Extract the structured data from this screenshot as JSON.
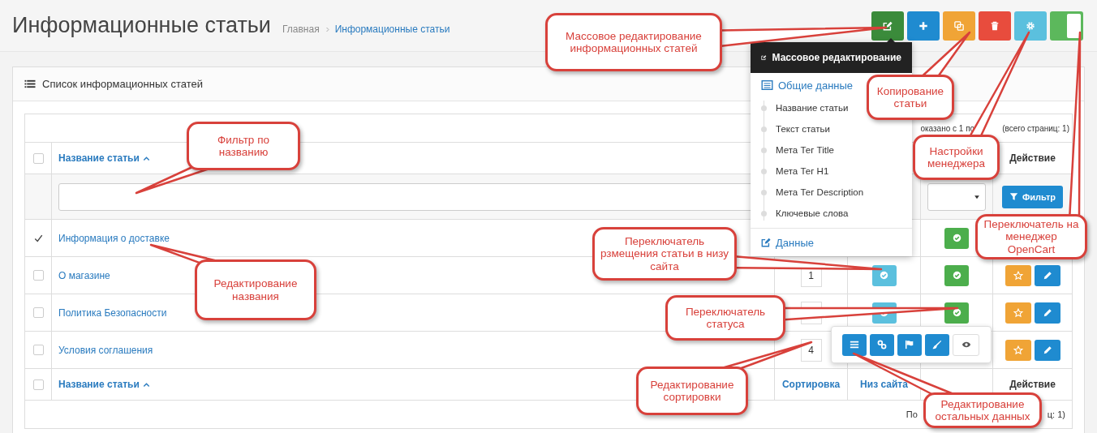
{
  "page": {
    "title": "Информационные статьи",
    "breadcrumb": [
      {
        "label": "Главная",
        "selected": false
      },
      {
        "label": "Информационные статьи",
        "selected": true
      }
    ]
  },
  "toolbar": [
    {
      "kind": "edit"
    },
    {
      "kind": "add"
    },
    {
      "kind": "copy"
    },
    {
      "kind": "delete"
    },
    {
      "kind": "settings"
    },
    {
      "kind": "toggle",
      "on": true
    }
  ],
  "panel": {
    "title": "Список информационных статей"
  },
  "pagination_top": [
    "оказано с 1 по",
    "(всего страниц: 1)"
  ],
  "table": {
    "header": {
      "checked": false,
      "name": "Название статьи",
      "action": "Действие"
    },
    "filter": {
      "button": "Фильтр"
    },
    "rows": [
      {
        "checked": true,
        "name": "Информация о доставке",
        "status_on": true
      },
      {
        "checked": false,
        "name": "О магазине",
        "sort": "1",
        "site_bottom_on": true,
        "status_on": true,
        "actions": true
      },
      {
        "checked": false,
        "name": "Политика Безопасности",
        "sort_field": true,
        "site_bottom_on": true,
        "status_on": true,
        "actions": true
      },
      {
        "checked": false,
        "name": "Условия соглашения",
        "sort": "4",
        "actions": true
      }
    ],
    "footer": {
      "checked": false,
      "name": "Название статьи",
      "sort": "Сортировка",
      "bottom": "Низ сайта",
      "action": "Действие"
    }
  },
  "pagination_bottom": [
    "По",
    "ц: 1)"
  ],
  "mass_edit_menu": {
    "title": "Массовое редактирование",
    "sections": [
      {
        "label": "Общие данные",
        "items": [
          "Название статьи",
          "Текст статьи",
          "Мета Тег Title",
          "Мета Тег H1",
          "Мета Тег Description",
          "Ключевые слова"
        ]
      },
      {
        "label": "Данные"
      }
    ]
  },
  "callouts": [
    {
      "text": "Массовое редактирование информационных статей"
    },
    {
      "text": "Копирование статьи"
    },
    {
      "text": "Настройки менеджера"
    },
    {
      "text": "Переключатель на менеджер OpenCart"
    },
    {
      "text": "Фильтр по названию"
    },
    {
      "text": "Переключатель рзмещения статьи в низу сайта"
    },
    {
      "text": "Редактирование названия"
    },
    {
      "text": "Переключатель статуса"
    },
    {
      "text": "Редактирование сортировки"
    },
    {
      "text": "Редактирование остальных данных"
    }
  ]
}
